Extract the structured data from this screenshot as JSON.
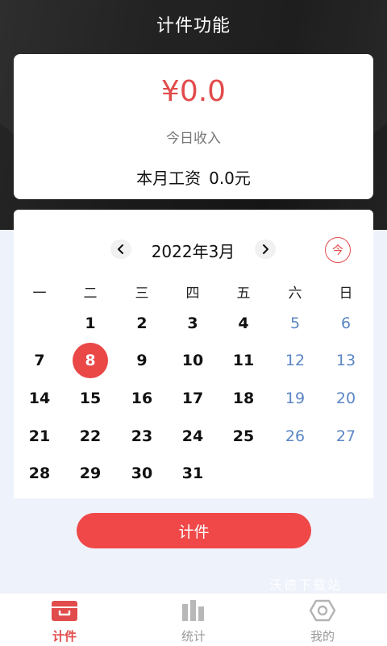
{
  "header": {
    "title": "计件功能"
  },
  "income": {
    "amount": "¥0.0",
    "label": "今日收入",
    "salary_label": "本月工资",
    "salary_value": "0.0元"
  },
  "calendar": {
    "month_label": "2022年3月",
    "today_label": "今",
    "weekdays": [
      "一",
      "二",
      "三",
      "四",
      "五",
      "六",
      "日"
    ],
    "selected_day": "8",
    "start_weekday_index": 1,
    "days": [
      "1",
      "2",
      "3",
      "4",
      "5",
      "6",
      "7",
      "8",
      "9",
      "10",
      "11",
      "12",
      "13",
      "14",
      "15",
      "16",
      "17",
      "18",
      "19",
      "20",
      "21",
      "22",
      "23",
      "24",
      "25",
      "26",
      "27",
      "28",
      "29",
      "30",
      "31"
    ]
  },
  "actions": {
    "count_button": "计件"
  },
  "watermark": "沃德下载站",
  "tabbar": {
    "items": [
      {
        "label": "计件",
        "icon": "piecework-icon",
        "active": true
      },
      {
        "label": "统计",
        "icon": "bar-chart-icon",
        "active": false
      },
      {
        "label": "我的",
        "icon": "hexagon-icon",
        "active": false
      }
    ]
  },
  "colors": {
    "accent": "#e24b4b",
    "weekend": "#5b86c5",
    "header_bg": "#1b1b1b",
    "page_bg": "#eef2fb"
  }
}
